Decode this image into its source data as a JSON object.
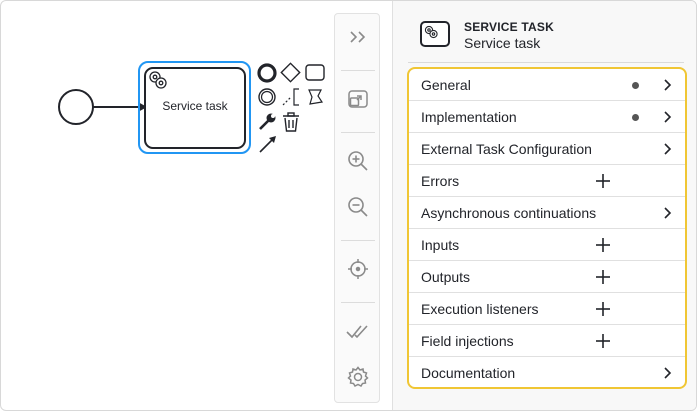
{
  "canvas": {
    "task": {
      "label": "Service task"
    }
  },
  "toolbar": {
    "items": [
      {
        "name": "collapse-icon"
      },
      {
        "name": "minimap-icon"
      },
      {
        "name": "zoom-in-icon"
      },
      {
        "name": "zoom-out-icon"
      },
      {
        "name": "reset-view-icon"
      },
      {
        "name": "validate-icon"
      },
      {
        "name": "settings-icon"
      }
    ]
  },
  "panel": {
    "header": {
      "type": "SERVICE TASK",
      "name": "Service task"
    },
    "groups": [
      {
        "label": "General",
        "indicator": "dot",
        "action": "chevron"
      },
      {
        "label": "Implementation",
        "indicator": "dot",
        "action": "chevron"
      },
      {
        "label": "External Task Configuration",
        "action": "chevron"
      },
      {
        "label": "Errors",
        "action": "plus"
      },
      {
        "label": "Asynchronous continuations",
        "action": "chevron"
      },
      {
        "label": "Inputs",
        "action": "plus"
      },
      {
        "label": "Outputs",
        "action": "plus"
      },
      {
        "label": "Execution listeners",
        "action": "plus"
      },
      {
        "label": "Field injections",
        "action": "plus"
      },
      {
        "label": "Documentation",
        "action": "chevron"
      }
    ]
  },
  "colors": {
    "selection": "#2196f3",
    "highlight": "#f0c634",
    "ink": "#22242a"
  }
}
